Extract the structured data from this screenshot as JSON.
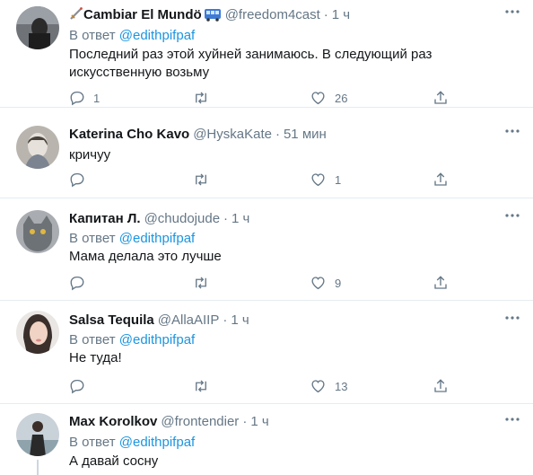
{
  "labels": {
    "reply_prefix": "В ответ"
  },
  "colors": {
    "text": "#14171a",
    "muted": "#657786",
    "link": "#1b95e0",
    "divider": "#e6ecf0"
  },
  "tweets": [
    {
      "name": "Cambiar El Mundö",
      "name_prefix_icon": "sword-icon",
      "name_suffix_icon": "bus-icon",
      "handle": "@freedom4cast",
      "time": "1 ч",
      "reply_to": "@edithpifpaf",
      "text": "Последний раз этой хуйней занимаюсь. В следующий раз искусственную возьму",
      "replies": "1",
      "retweets": "",
      "likes": "26"
    },
    {
      "name": "Katerina Cho Kavo",
      "handle": "@HyskaKate",
      "time": "51 мин",
      "text": "кричуу",
      "replies": "",
      "retweets": "",
      "likes": "1"
    },
    {
      "name": "Капитан Л.",
      "handle": "@chudojude",
      "time": "1 ч",
      "reply_to": "@edithpifpaf",
      "text": "Мама делала это лучше",
      "replies": "",
      "retweets": "",
      "likes": "9"
    },
    {
      "name": "Salsa Tequila",
      "handle": "@AllaAIIP",
      "time": "1 ч",
      "reply_to": "@edithpifpaf",
      "text": "Не туда!",
      "replies": "",
      "retweets": "",
      "likes": "13"
    },
    {
      "name": "Max Korolkov",
      "handle": "@frontendier",
      "time": "1 ч",
      "reply_to": "@edithpifpaf",
      "text": "А давай сосну"
    }
  ]
}
